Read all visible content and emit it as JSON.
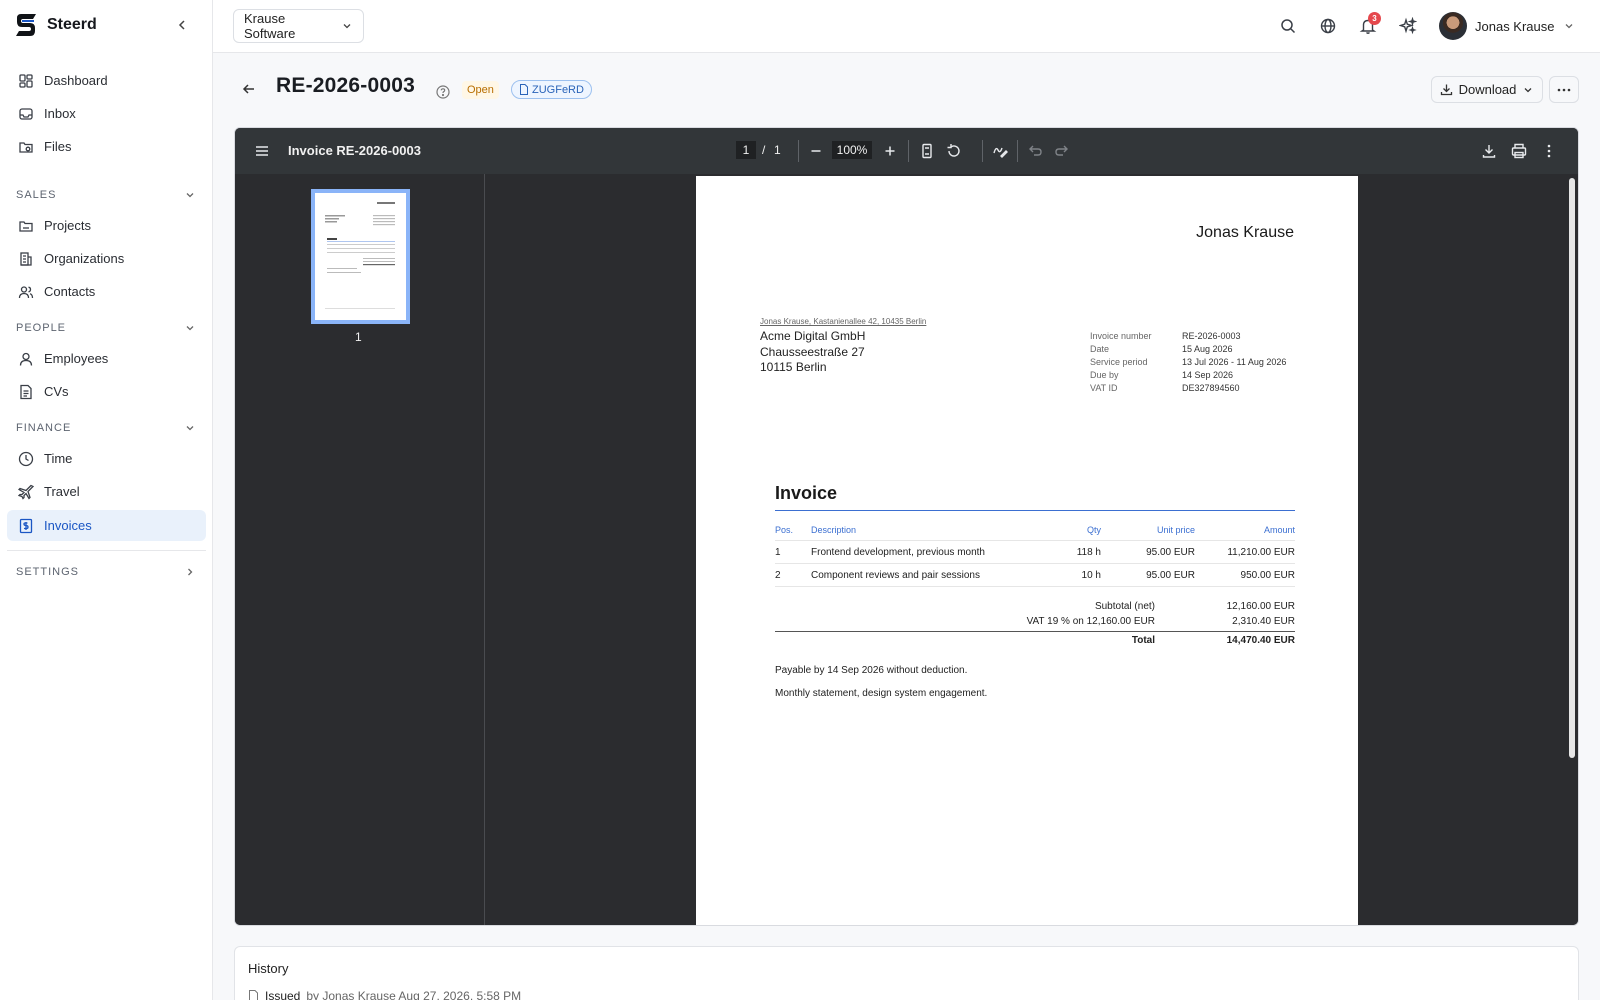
{
  "app": {
    "name": "Steerd"
  },
  "sidebar": {
    "items_top": [
      {
        "label": "Dashboard",
        "icon": "dashboard-icon"
      },
      {
        "label": "Inbox",
        "icon": "inbox-icon"
      },
      {
        "label": "Files",
        "icon": "folder-icon"
      }
    ],
    "sections": [
      {
        "label": "SALES",
        "items": [
          {
            "label": "Projects",
            "icon": "folder-icon"
          },
          {
            "label": "Organizations",
            "icon": "building-icon"
          },
          {
            "label": "Contacts",
            "icon": "users-icon"
          }
        ]
      },
      {
        "label": "PEOPLE",
        "items": [
          {
            "label": "Employees",
            "icon": "user-icon"
          },
          {
            "label": "CVs",
            "icon": "document-icon"
          }
        ]
      },
      {
        "label": "FINANCE",
        "items": [
          {
            "label": "Time",
            "icon": "clock-icon"
          },
          {
            "label": "Travel",
            "icon": "plane-icon"
          },
          {
            "label": "Invoices",
            "icon": "invoice-icon",
            "active": true
          }
        ]
      }
    ],
    "settings_label": "SETTINGS"
  },
  "topbar": {
    "org": "Krause Software",
    "notifications_count": "3",
    "user_name": "Jonas Krause"
  },
  "header": {
    "title": "RE-2026-0003",
    "status": "Open",
    "format_badge": "ZUGFeRD",
    "download_label": "Download"
  },
  "viewer": {
    "title": "Invoice RE-2026-0003",
    "page_current": "1",
    "page_sep": "/",
    "page_total": "1",
    "zoom": "100%",
    "thumb_label": "1"
  },
  "invoice": {
    "sender": "Jonas Krause",
    "return_address": "Jonas Krause, Kastanienallee 42, 10435 Berlin",
    "recipient": [
      "Acme Digital GmbH",
      "Chausseestraße 27",
      "10115 Berlin"
    ],
    "meta": [
      {
        "key": "Invoice number",
        "value": "RE-2026-0003"
      },
      {
        "key": "Date",
        "value": "15 Aug 2026"
      },
      {
        "key": "Service period",
        "value": "13 Jul 2026 - 11 Aug 2026"
      },
      {
        "key": "Due by",
        "value": "14 Sep 2026"
      },
      {
        "key": "VAT ID",
        "value": "DE327894560"
      }
    ],
    "heading": "Invoice",
    "columns": {
      "pos": "Pos.",
      "desc": "Description",
      "qty": "Qty",
      "unit": "Unit price",
      "amount": "Amount"
    },
    "rows": [
      {
        "pos": "1",
        "desc": "Frontend development, previous month",
        "qty": "118 h",
        "unit": "95.00 EUR",
        "amount": "11,210.00 EUR"
      },
      {
        "pos": "2",
        "desc": "Component reviews and pair sessions",
        "qty": "10 h",
        "unit": "95.00 EUR",
        "amount": "950.00 EUR"
      }
    ],
    "subtotal_label": "Subtotal (net)",
    "subtotal": "12,160.00 EUR",
    "vat_label": "VAT 19 % on 12,160.00 EUR",
    "vat": "2,310.40 EUR",
    "total_label": "Total",
    "total": "14,470.40 EUR",
    "note_payment": "Payable by 14 Sep 2026 without deduction.",
    "note_statement": "Monthly statement, design system engagement."
  },
  "history": {
    "title": "History",
    "entry_action": "Issued",
    "entry_detail": "by Jonas Krause Aug 27, 2026, 5:58 PM"
  },
  "colors": {
    "accent": "#1a56c4",
    "active_bg": "#e9f1fb",
    "viewer_bg": "#2b2c2f",
    "badge": "#e5484d"
  }
}
